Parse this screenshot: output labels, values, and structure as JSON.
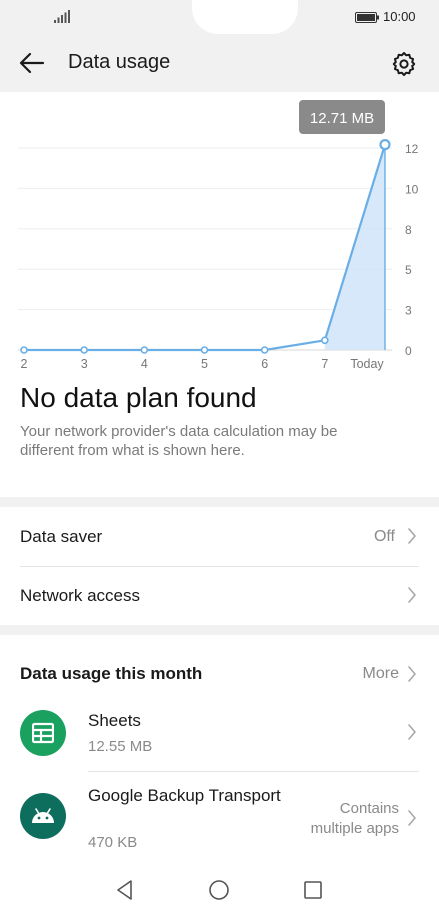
{
  "status_bar": {
    "time": "10:00",
    "signal_icon": "signal-icon",
    "battery_icon": "battery-icon"
  },
  "app_bar": {
    "title": "Data usage",
    "back_icon": "back-arrow-icon",
    "settings_icon": "gear-icon"
  },
  "chart_data": {
    "type": "area",
    "categories": [
      "2",
      "3",
      "4",
      "5",
      "6",
      "7",
      "Today"
    ],
    "values": [
      0,
      0,
      0,
      0,
      0,
      0.6,
      12.71
    ],
    "tooltip": "12.71 MB",
    "y_ticks": [
      "0",
      "3",
      "5",
      "8",
      "10",
      "12"
    ],
    "y_tick_values": [
      0,
      2.5,
      5,
      7.5,
      10,
      12.5
    ],
    "ylim": [
      0,
      12.5
    ],
    "grid": true,
    "y_axis_position": "right",
    "line_color": "#6aaee6",
    "fill_color": "#cfe4f8"
  },
  "plan": {
    "title": "No data plan found",
    "description": "Your network provider's data calculation may be different from what is shown here."
  },
  "settings": [
    {
      "label": "Data saver",
      "value": "Off"
    },
    {
      "label": "Network access",
      "value": ""
    }
  ],
  "usage": {
    "section_title": "Data usage this month",
    "more_label": "More",
    "apps": [
      {
        "name": "Sheets",
        "size": "12.55 MB",
        "note": "",
        "icon": "sheets-icon",
        "color": "#1aa15f"
      },
      {
        "name": "Google Backup Transport",
        "size": "470 KB",
        "note": "Contains multiple apps",
        "icon": "android-icon",
        "color": "#0e6e5e"
      }
    ]
  },
  "navigation": {
    "back_icon": "nav-back-icon",
    "home_icon": "nav-home-icon",
    "recents_icon": "nav-recents-icon"
  }
}
